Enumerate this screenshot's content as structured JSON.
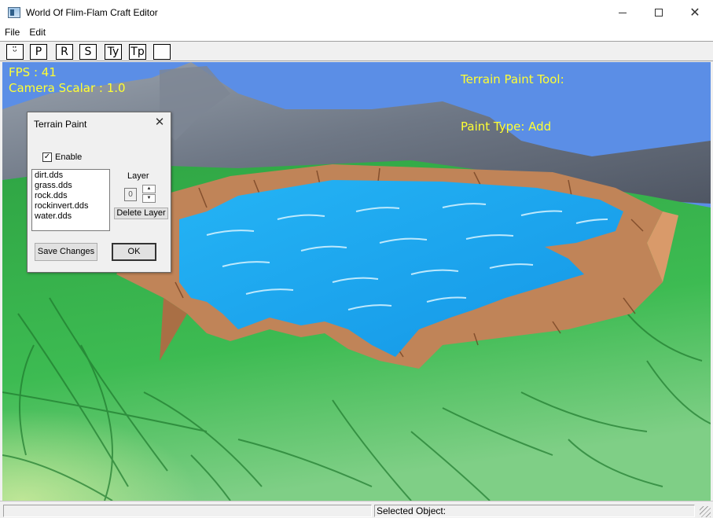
{
  "window": {
    "title": "World Of Flim-Flam Craft Editor",
    "close_glyph": "✕"
  },
  "menu": {
    "items": [
      "File",
      "Edit"
    ]
  },
  "toolbar": {
    "buttons": [
      "ᵕ̈",
      "P",
      "R",
      "S",
      "Ty",
      "Tp",
      ""
    ]
  },
  "hud": {
    "fps": "FPS : 41",
    "camera_scalar": "Camera Scalar : 1.0",
    "tool": "Terrain Paint Tool:",
    "paint_type": "Paint Type: Add",
    "color": "#ffff33"
  },
  "dialog": {
    "title": "Terrain Paint",
    "close_glyph": "✕",
    "enable_label": "Enable",
    "enable_checked": true,
    "check_glyph": "✓",
    "textures": [
      "dirt.dds",
      "grass.dds",
      "rock.dds",
      "rockinvert.dds",
      "water.dds"
    ],
    "layer_label": "Layer",
    "layer_value": "0",
    "spin_up_glyph": "▲",
    "spin_down_glyph": "▼",
    "delete_label": "Delete Layer",
    "save_label": "Save Changes",
    "ok_label": "OK"
  },
  "status": {
    "selected_object": "Selected Object:"
  },
  "colors": {
    "sky": "#5b8ee6",
    "grass": "#3fb04f",
    "water": "#1aa5ef",
    "dirt": "#c08458",
    "rock": "#6f7784"
  }
}
